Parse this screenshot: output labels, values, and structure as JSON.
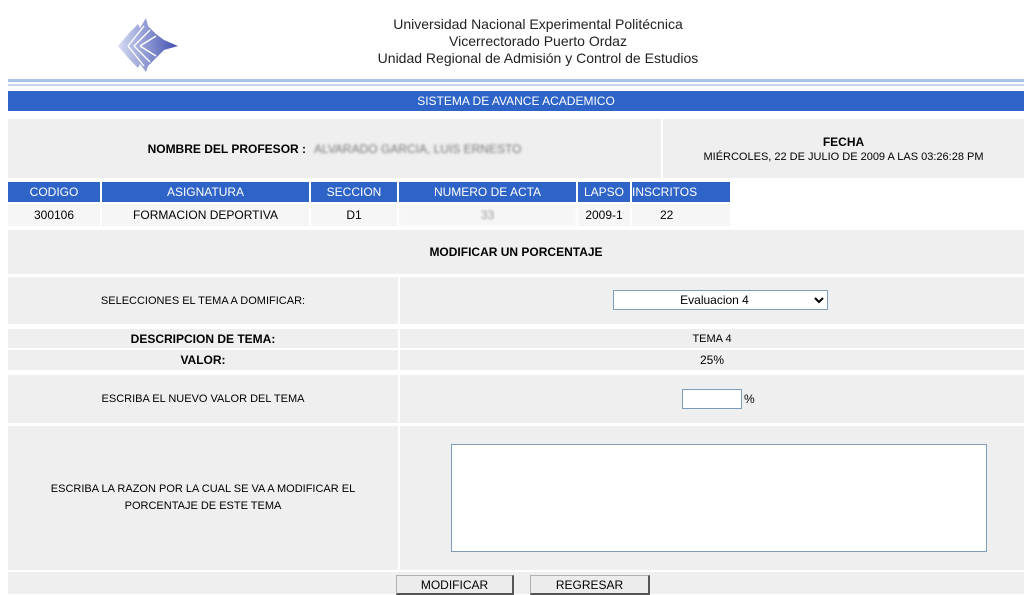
{
  "header": {
    "line1": "Universidad Nacional Experimental Politécnica",
    "line2": "Vicerrectorado Puerto Ordaz",
    "line3": "Unidad Regional de Admisión y Control de Estudios"
  },
  "system_title": "SISTEMA DE AVANCE ACADEMICO",
  "professor": {
    "label": "NOMBRE DEL PROFESOR :",
    "name": "ALVARADO GARCIA, LUIS ERNESTO"
  },
  "fecha": {
    "label": "FECHA",
    "value": "MIÉRCOLES, 22 DE JULIO DE 2009 A LAS 03:26:28 PM"
  },
  "table": {
    "headers": [
      "CODIGO",
      "ASIGNATURA",
      "SECCION",
      "NUMERO DE ACTA",
      "LAPSO",
      "INSCRITOS"
    ],
    "row": [
      "300106",
      "FORMACION DEPORTIVA",
      "D1",
      "33",
      "2009-1",
      "22"
    ]
  },
  "section_title": "MODIFICAR UN PORCENTAJE",
  "form": {
    "select_label": "SELECCIONES EL TEMA A DOMIFICAR:",
    "select_value": "Evaluacion 4",
    "desc_label": "DESCRIPCION DE TEMA:",
    "desc_value": "TEMA 4",
    "valor_label": "VALOR:",
    "valor_value": "25%",
    "new_value_label": "ESCRIBA EL NUEVO VALOR DEL TEMA",
    "new_value": "",
    "percent_sign": "%",
    "reason_label": "ESCRIBA LA RAZON POR LA CUAL SE VA A MODIFICAR EL PORCENTAJE DE ESTE TEMA",
    "reason_value": ""
  },
  "buttons": {
    "modify": "MODIFICAR",
    "back": "REGRESAR"
  }
}
